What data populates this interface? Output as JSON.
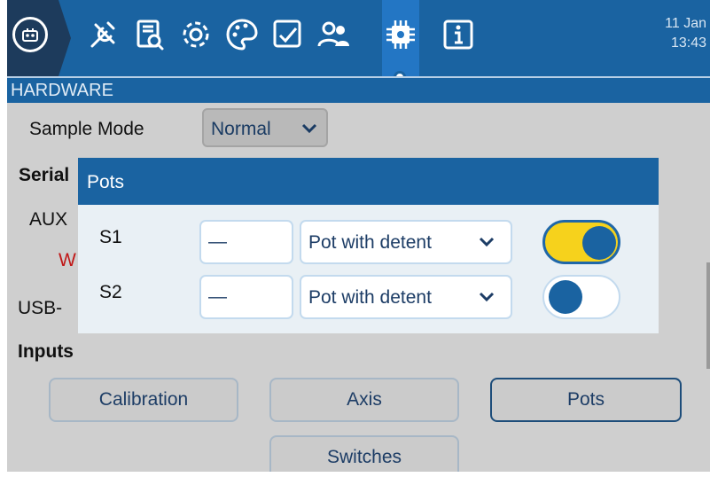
{
  "topbar": {
    "tabs": [
      {
        "name": "model-select",
        "icon": "robot-icon"
      },
      {
        "name": "radio-setup",
        "icon": "tools-icon"
      },
      {
        "name": "model-settings",
        "icon": "model-icon"
      },
      {
        "name": "settings",
        "icon": "gear-icon"
      },
      {
        "name": "theme",
        "icon": "palette-icon"
      },
      {
        "name": "checklist",
        "icon": "checklist-icon"
      },
      {
        "name": "users",
        "icon": "users-icon"
      },
      {
        "name": "hardware",
        "icon": "chip-icon",
        "active": true
      },
      {
        "name": "info",
        "icon": "info-icon"
      }
    ],
    "date": "11 Jan",
    "time": "13:43"
  },
  "section": {
    "title": "HARDWARE"
  },
  "body": {
    "sample_mode_label": "Sample Mode",
    "sample_mode_value": "Normal",
    "serial_label": "Serial",
    "aux_label": "AUX",
    "warning_label": "W",
    "usb_label": "USB-",
    "inputs_label": "Inputs",
    "buttons": {
      "calibration": "Calibration",
      "axis": "Axis",
      "pots": "Pots",
      "switches": "Switches"
    }
  },
  "dialog": {
    "title": "Pots",
    "rows": [
      {
        "label": "S1",
        "name_value": "—",
        "type_value": "Pot with detent",
        "enabled": true
      },
      {
        "label": "S2",
        "name_value": "—",
        "type_value": "Pot with detent",
        "enabled": false
      }
    ]
  },
  "colors": {
    "primary": "#1a63a1",
    "home_dark": "#1d3b5c",
    "toggle_on": "#f6d21c",
    "warning": "#c01818"
  }
}
